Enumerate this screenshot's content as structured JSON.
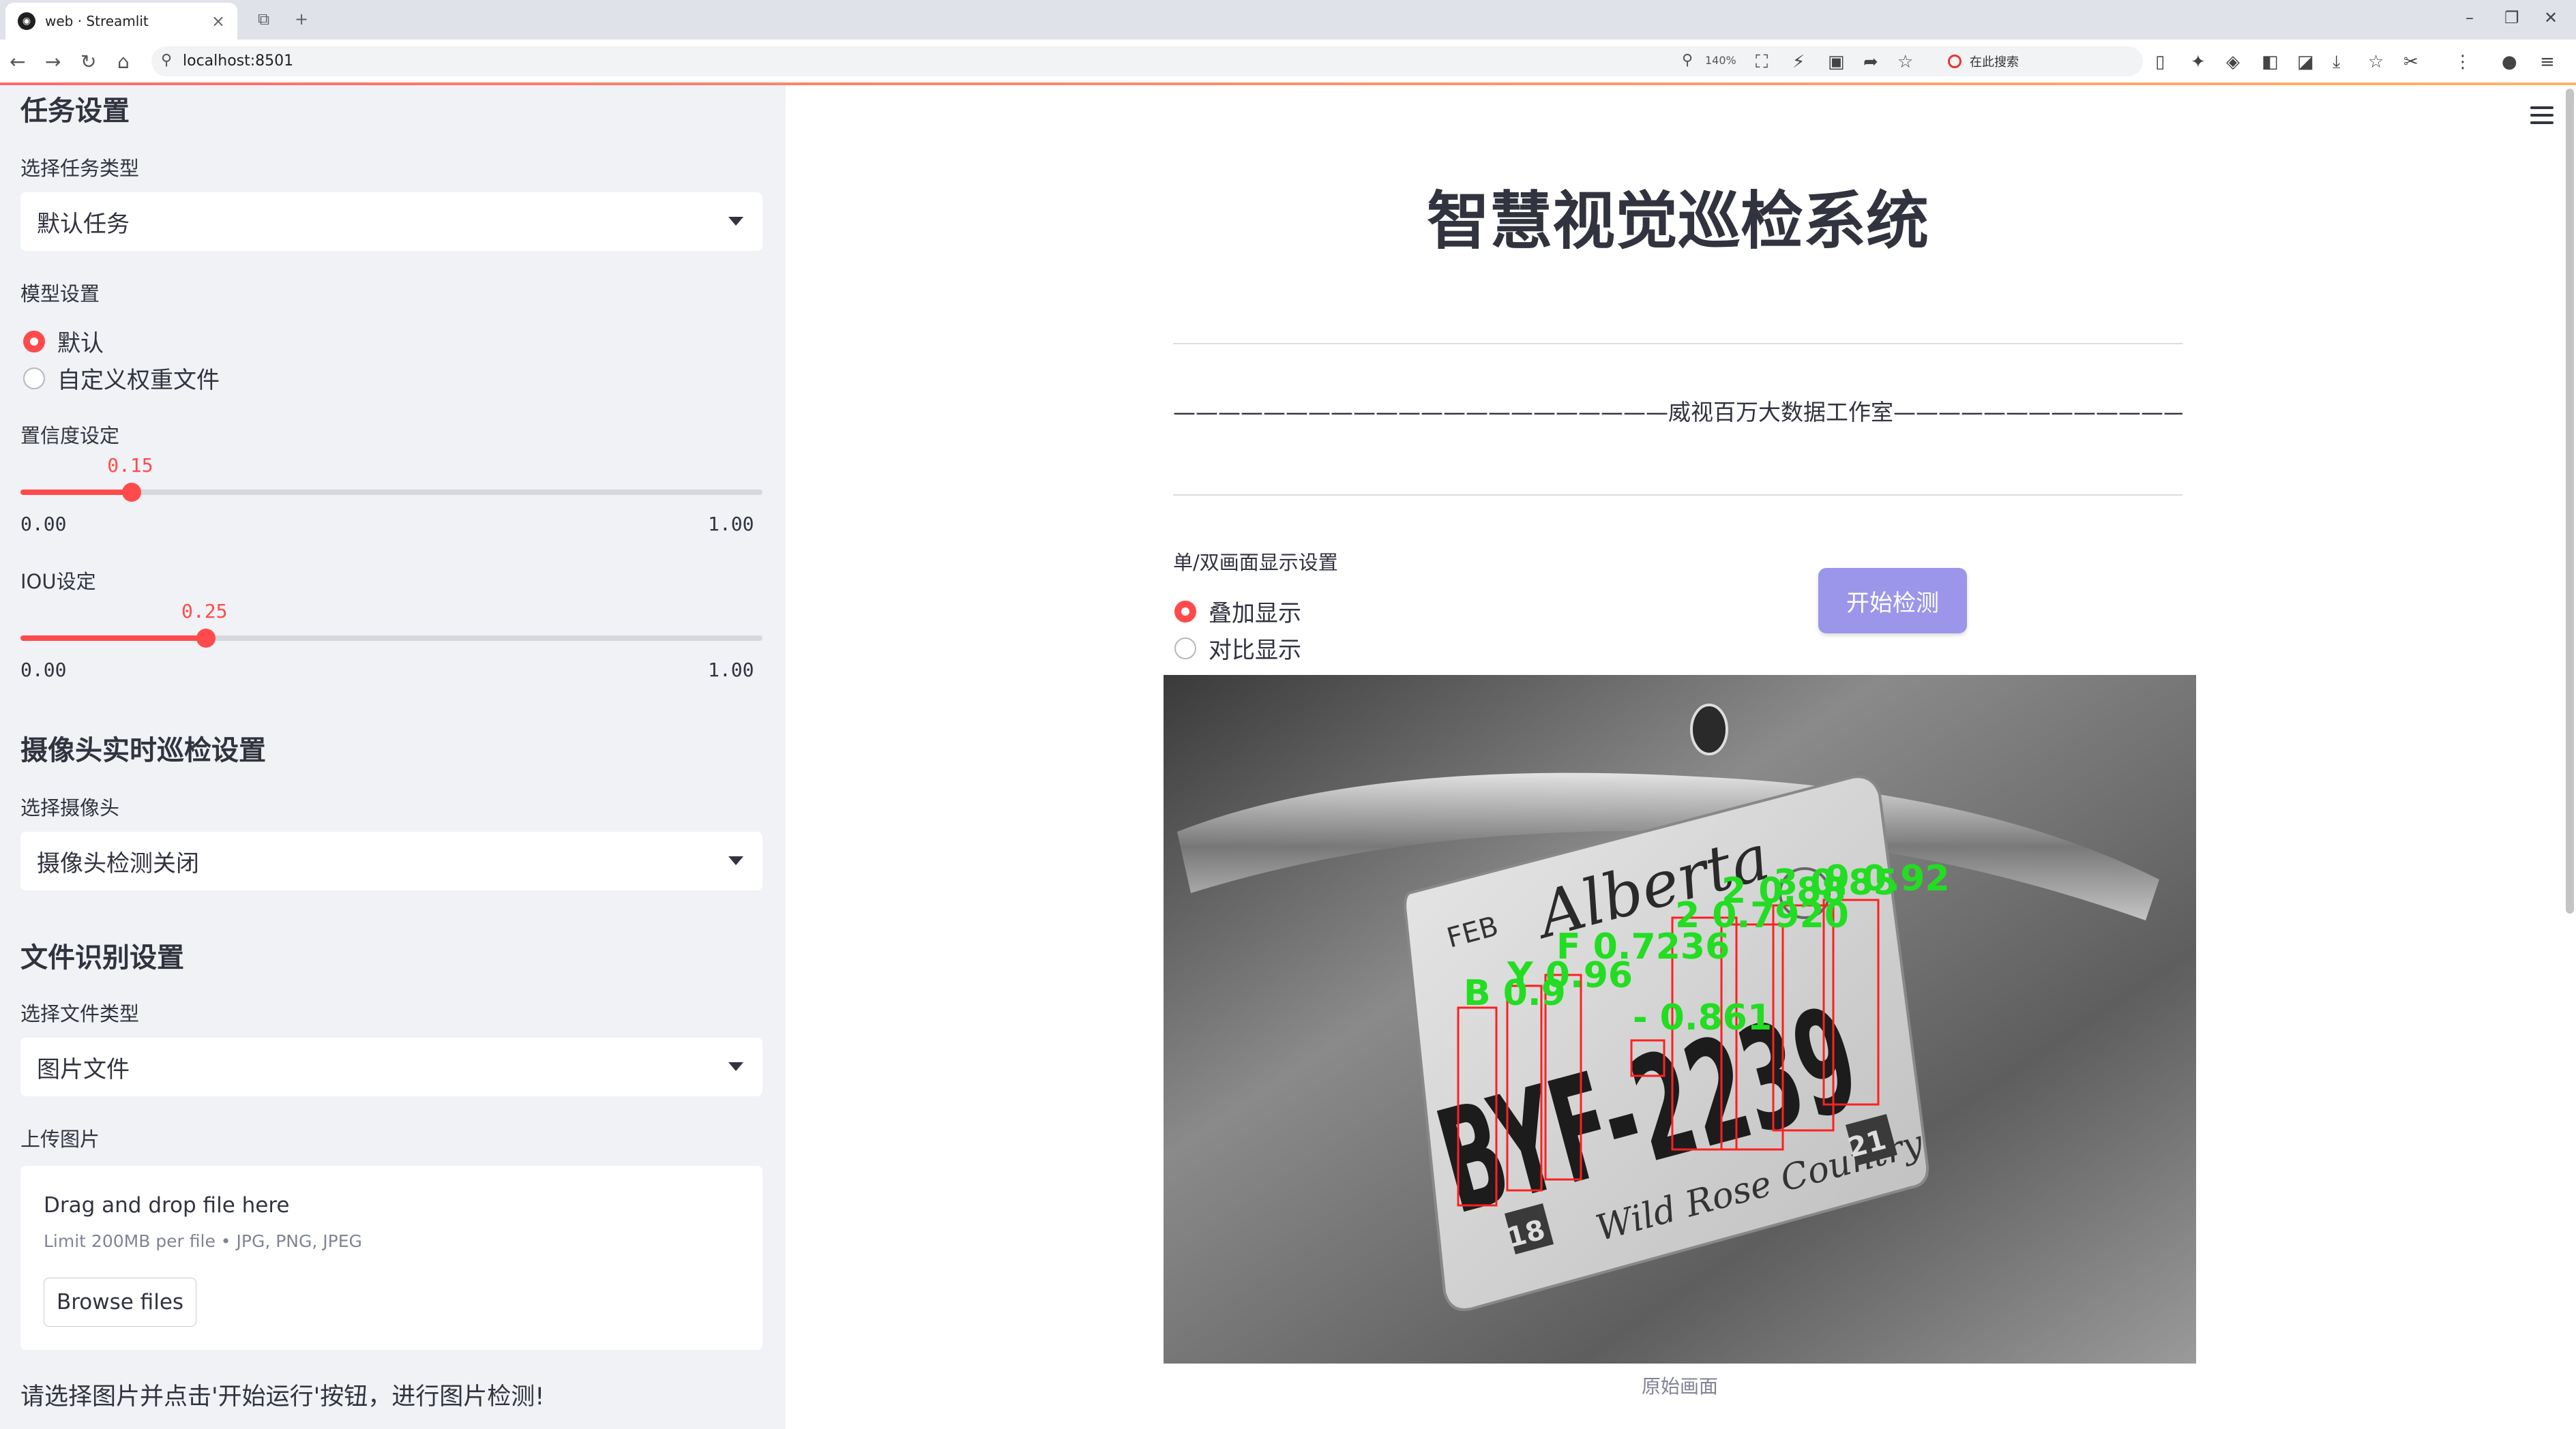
{
  "browser": {
    "tab_title": "web · Streamlit",
    "url": "localhost:8501",
    "zoom": "140%",
    "search_placeholder": "在此搜索"
  },
  "sidebar": {
    "task_section": "任务设置",
    "task_type_label": "选择任务类型",
    "task_type_value": "默认任务",
    "model_label": "模型设置",
    "model_options": [
      "默认",
      "自定义权重文件"
    ],
    "model_selected": 0,
    "conf_label": "置信度设定",
    "conf_value": "0.15",
    "conf_fraction": 0.15,
    "conf_min": "0.00",
    "conf_max": "1.00",
    "iou_label": "IOU设定",
    "iou_value": "0.25",
    "iou_fraction": 0.25,
    "iou_min": "0.00",
    "iou_max": "1.00",
    "camera_section": "摄像头实时巡检设置",
    "camera_label": "选择摄像头",
    "camera_value": "摄像头检测关闭",
    "file_section": "文件识别设置",
    "file_type_label": "选择文件类型",
    "file_type_value": "图片文件",
    "upload_label": "上传图片",
    "drop_text": "Drag and drop file here",
    "limit_text": "Limit 200MB per file • JPG, PNG, JPEG",
    "browse_label": "Browse files",
    "hint": "请选择图片并点击'开始运行'按钮，进行图片检测!"
  },
  "main": {
    "title": "智慧视觉巡检系统",
    "studio": "——————————————————————威视百万大数据工作室———————————————————————",
    "display_label": "单/双画面显示设置",
    "display_options": [
      "叠加显示",
      "对比显示"
    ],
    "display_selected": 0,
    "start_button": "开始检测",
    "caption": "原始画面"
  },
  "plate": {
    "header_left": "FEB",
    "province": "Alberta",
    "number": "BYF-2239",
    "county": "Wild Rose Country",
    "month_sticker": "18",
    "year_sticker": "21"
  },
  "detections": [
    {
      "label": "B",
      "score": "0.",
      "box": [
        0,
        0,
        0,
        0
      ]
    },
    {
      "label": "Y",
      "score": "0.96"
    },
    {
      "label": "F",
      "score": "0.7236"
    },
    {
      "label": "-",
      "score": "0.861"
    },
    {
      "label": "2",
      "score": "0.7920"
    },
    {
      "label": "2",
      "score": "0.88"
    },
    {
      "label": "3",
      "score": "0.85"
    },
    {
      "label": "9",
      "score": "0.92"
    }
  ],
  "detection_labels_drawn": [
    "B 0.9",
    "Y 0.96",
    "F 0.7236",
    "- 0.861",
    "2 0.7920",
    "2 0.88",
    "3 0.85",
    "9 0.92"
  ],
  "colors": {
    "accent": "#ff4b4b",
    "button": "#9b96ea",
    "sidebar_bg": "#f0f2f6",
    "box": "#ff2020",
    "label": "#22dd22"
  }
}
